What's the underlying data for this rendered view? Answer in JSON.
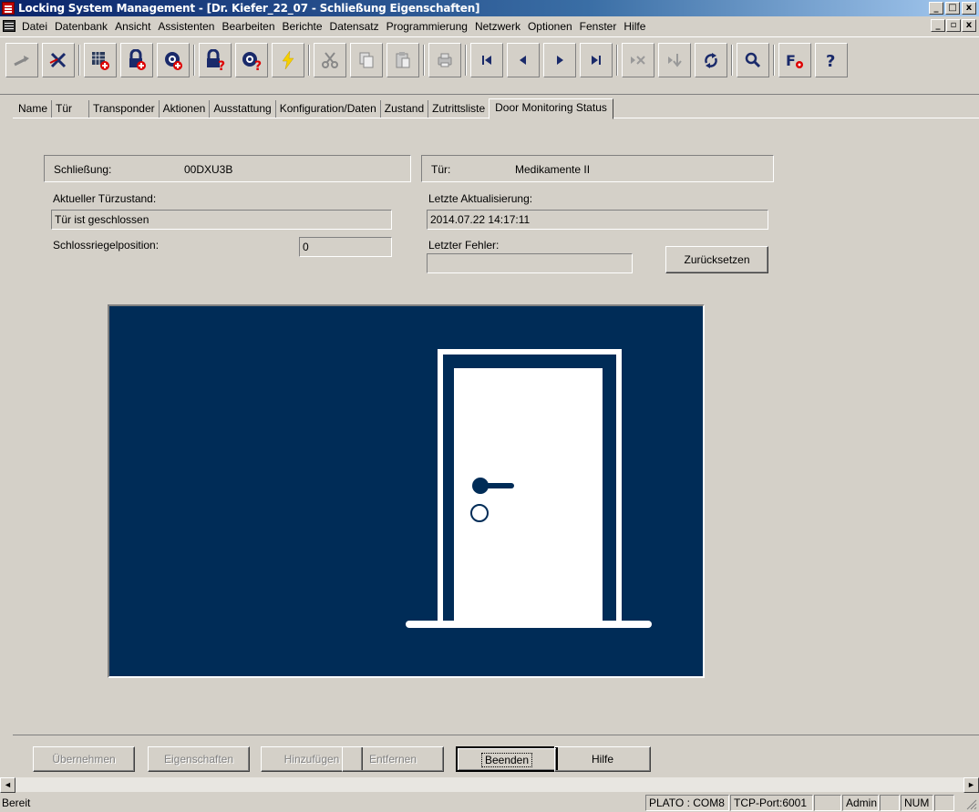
{
  "window": {
    "title": "Locking System Management - [Dr. Kiefer_22_07 - Schließung Eigenschaften]",
    "buttons": {
      "minimize": "_",
      "maximize": "□",
      "close": "x"
    }
  },
  "menu": [
    "Datei",
    "Datenbank",
    "Ansicht",
    "Assistenten",
    "Bearbeiten",
    "Berichte",
    "Datensatz",
    "Programmierung",
    "Netzwerk",
    "Optionen",
    "Fenster",
    "Hilfe"
  ],
  "mdi_buttons": {
    "minimize": "_",
    "restore": "▫",
    "close": "x"
  },
  "tabs": [
    "Name",
    "Tür",
    "Transponder",
    "Aktionen",
    "Ausstattung",
    "Konfiguration/Daten",
    "Zustand",
    "Zutrittsliste",
    "Door Monitoring Status"
  ],
  "active_tab": "Door Monitoring Status",
  "details": {
    "schliessung_label": "Schließung:",
    "schliessung_value": "00DXU3B",
    "tuer_label": "Tür:",
    "tuer_value": "Medikamente II",
    "tuerzustand_label": "Aktueller Türzustand:",
    "tuerzustand_value": "Tür ist geschlossen",
    "riegel_label": "Schlossriegelposition:",
    "riegel_value": "0",
    "aktualisierung_label": "Letzte Aktualisierung:",
    "aktualisierung_value": "2014.07.22 14:17:11",
    "fehler_label": "Letzter Fehler:",
    "fehler_value": "",
    "reset_button": "Zurücksetzen"
  },
  "door_state": "closed",
  "colors": {
    "door_panel_bg": "#002c57",
    "door_fg": "#ffffff"
  },
  "bottom_buttons": {
    "uebernehmen": "Übernehmen",
    "eigenschaften": "Eigenschaften",
    "hinzufuegen": "Hinzufügen",
    "entfernen": "Entfernen",
    "beenden": "Beenden",
    "hilfe": "Hilfe"
  },
  "scroll_arrows": {
    "left": "◄",
    "right": "►"
  },
  "status": {
    "text": "Bereit",
    "port": "PLATO : COM8",
    "tcp": "TCP-Port:6001",
    "user": "Admin",
    "num": "NUM"
  },
  "toolbar_icons": [
    "login-icon",
    "logout-icon",
    "new-system-icon",
    "new-lock-icon",
    "new-transponder-icon",
    "lock-query-icon",
    "transponder-query-icon",
    "program-icon",
    "cut-icon",
    "copy-icon",
    "paste-icon",
    "print-icon",
    "first-record-icon",
    "previous-record-icon",
    "next-record-icon",
    "last-record-icon",
    "delete-record-icon",
    "insert-record-icon",
    "refresh-icon",
    "search-icon",
    "function-settings-icon",
    "help-icon"
  ]
}
